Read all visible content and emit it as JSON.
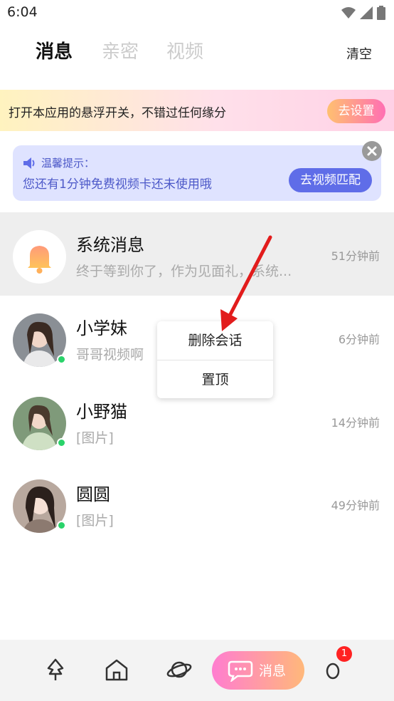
{
  "status_bar": {
    "time": "6:04"
  },
  "header": {
    "tabs": [
      {
        "label": "消息",
        "active": true
      },
      {
        "label": "亲密",
        "active": false
      },
      {
        "label": "视频",
        "active": false
      }
    ],
    "clear_label": "清空"
  },
  "float_banner": {
    "text": "打开本应用的悬浮开关，不错过任何缘分",
    "button": "去设置"
  },
  "tip": {
    "title": "温馨提示：",
    "text": "您还有1分钟免费视频卡还未使用哦",
    "button": "去视频匹配"
  },
  "conversations": [
    {
      "name": "系统消息",
      "preview": "终于等到你了，作为见面礼，系统...",
      "time": "51分钟前",
      "avatar": "bell-icon",
      "online": false
    },
    {
      "name": "小学妹",
      "preview": "哥哥视频啊",
      "time": "6分钟前",
      "avatar": "user-photo",
      "online": true
    },
    {
      "name": "小野猫",
      "preview": "[图片]",
      "time": "14分钟前",
      "avatar": "user-photo",
      "online": true
    },
    {
      "name": "圆圆",
      "preview": "[图片]",
      "time": "49分钟前",
      "avatar": "user-photo",
      "online": true
    }
  ],
  "context_menu": {
    "items": [
      "删除会话",
      "置顶"
    ]
  },
  "bottom_nav": {
    "items": [
      "plant-icon",
      "home-icon",
      "planet-icon",
      "chat-icon",
      "profile-icon"
    ],
    "active_label": "消息",
    "badge": "1"
  },
  "colors": {
    "accent_blue": "#5f6de8",
    "online": "#2ad36a",
    "badge": "#ff2222"
  }
}
